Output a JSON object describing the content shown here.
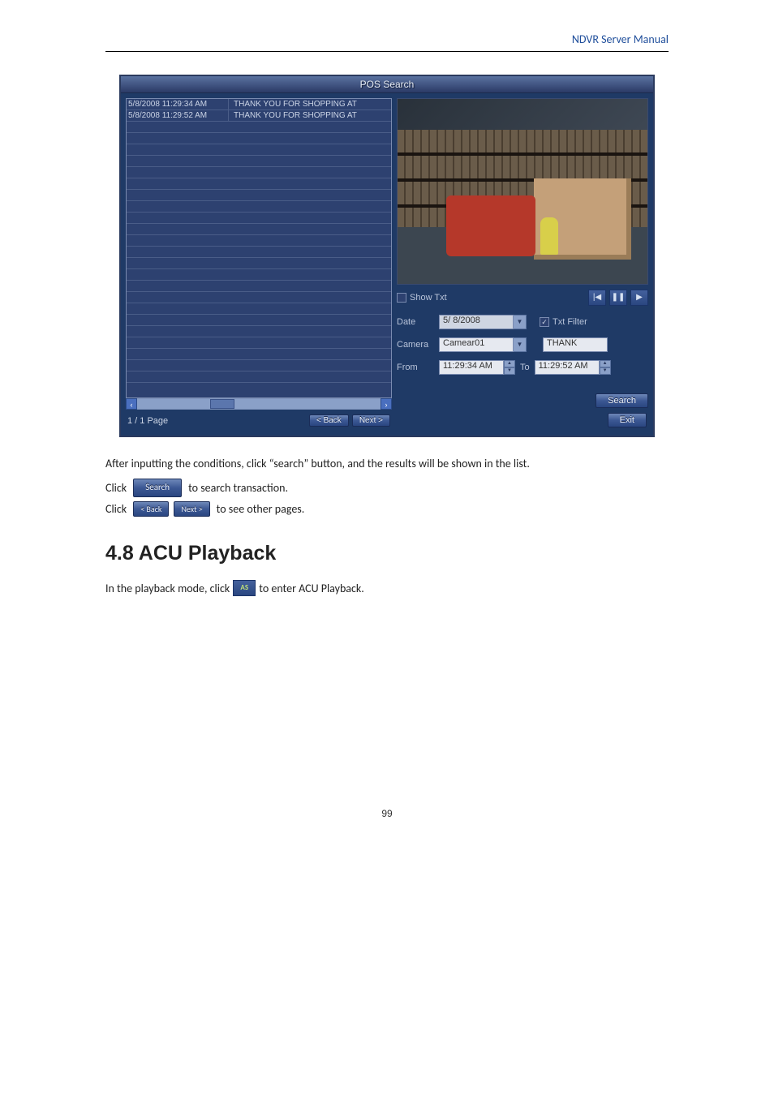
{
  "header": {
    "manual_title": "NDVR Server Manual"
  },
  "pos": {
    "title": "POS Search",
    "results": [
      {
        "time": "5/8/2008 11:29:34 AM",
        "text": "THANK YOU FOR SHOPPING AT"
      },
      {
        "time": "5/8/2008 11:29:52 AM",
        "text": "THANK YOU FOR SHOPPING AT"
      }
    ],
    "pagination": {
      "label": "1 / 1 Page",
      "back": "< Back",
      "next": "Next >"
    },
    "show_txt_label": "Show Txt",
    "play_buttons": {
      "rewind": "|◀",
      "pause": "❚❚",
      "play": "▶"
    },
    "form": {
      "date_label": "Date",
      "date_value": "5/ 8/2008",
      "txtfilter_label": "Txt Filter",
      "camera_label": "Camera",
      "camera_value": "Camear01",
      "filter_value": "THANK",
      "from_label": "From",
      "from_value": "11:29:34 AM",
      "to_label": "To",
      "to_value": "11:29:52 AM"
    },
    "search_btn": "Search",
    "exit_btn": "Exit"
  },
  "body": {
    "p1": "After inputting the conditions, click “search” button, and the results will be shown in the list.",
    "p2_a": "Click",
    "p2_b": "to search transaction.",
    "p3_a": "Click",
    "p3_b": "to see other pages.",
    "heading": "4.8 ACU Playback",
    "p4_a": "In the playback mode, click",
    "p4_b": "to enter ACU Playback.",
    "as_label": "AS",
    "btn_search": "Search",
    "btn_back": "< Back",
    "btn_next": "Next >"
  },
  "page_number": "99"
}
